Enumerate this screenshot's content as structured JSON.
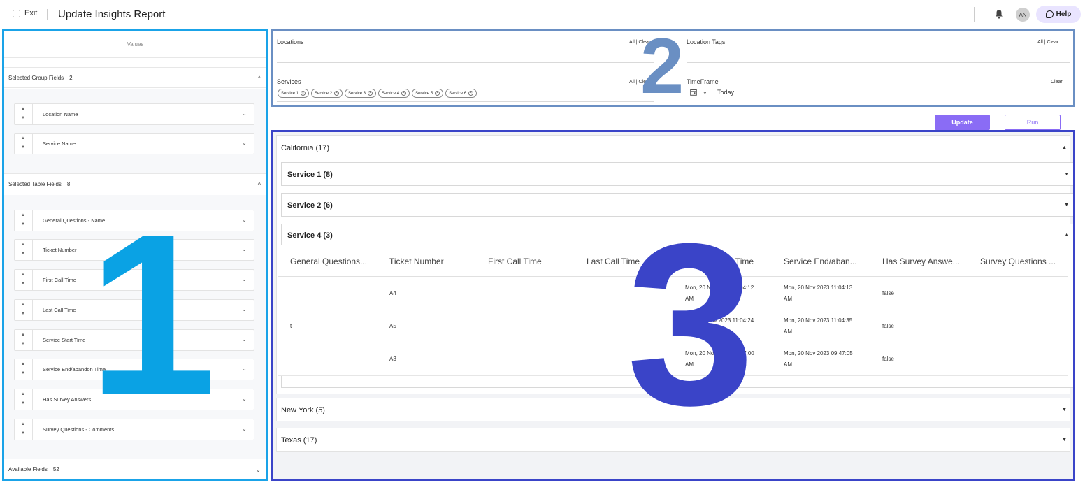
{
  "header": {
    "exit_label": "Exit",
    "title": "Update Insights Report",
    "avatar_initials": "AN",
    "help_label": "Help"
  },
  "left_panel": {
    "marker": "1",
    "values_label": "Values",
    "group_fields": {
      "label": "Selected Group Fields",
      "count": "2",
      "items": [
        "Location Name",
        "Service Name"
      ]
    },
    "table_fields": {
      "label": "Selected Table Fields",
      "count": "8",
      "items": [
        "General Questions - Name",
        "Ticket Number",
        "First Call Time",
        "Last Call Time",
        "Service Start Time",
        "Service End/abandon Time",
        "Has Survey Answers",
        "Survey Questions - Comments"
      ]
    },
    "available_fields": {
      "label": "Available Fields",
      "count": "52"
    }
  },
  "filters": {
    "marker": "2",
    "locations": {
      "label": "Locations",
      "actions": "All | Clear"
    },
    "location_tags": {
      "label": "Location Tags",
      "actions": "All | Clear"
    },
    "services": {
      "label": "Services",
      "actions": "All | Clear",
      "chips": [
        "Service 1",
        "Service 2",
        "Service 3",
        "Service 4",
        "Service 5",
        "Service 6"
      ]
    },
    "timeframe": {
      "label": "TimeFrame",
      "value": "Today",
      "clear": "Clear"
    }
  },
  "actions": {
    "update_label": "Update",
    "run_label": "Run"
  },
  "results": {
    "marker": "3",
    "groups": [
      {
        "title": "California (17)"
      },
      {
        "title": "New York (5)"
      },
      {
        "title": "Texas (17)"
      }
    ],
    "subgroups": [
      {
        "title": "Service 1 (8)"
      },
      {
        "title": "Service 2 (6)"
      },
      {
        "title": "Service 4 (3)"
      }
    ],
    "columns": [
      "General Questions...",
      "Ticket Number",
      "First Call Time",
      "Last Call Time",
      "Service Start Time",
      "Service End/aban...",
      "Has Survey Answe...",
      "Survey Questions ..."
    ],
    "rows": [
      {
        "general": "",
        "ticket": "A4",
        "start_l1": "Mon, 20 Nov 2023 11:04:12",
        "start_l2": "AM",
        "end_l1": "Mon, 20 Nov 2023 11:04:13",
        "end_l2": "AM",
        "survey": "false"
      },
      {
        "general": "t",
        "ticket": "A5",
        "start_l1": "Mon, 20 Nov 2023 11:04:24",
        "start_l2": "AM",
        "end_l1": "Mon, 20 Nov 2023 11:04:35",
        "end_l2": "AM",
        "survey": "false"
      },
      {
        "general": "",
        "ticket": "A3",
        "start_l1": "Mon, 20 Nov 2023 09:47:00",
        "start_l2": "AM",
        "end_l1": "Mon, 20 Nov 2023 09:47:05",
        "end_l2": "AM",
        "survey": "false"
      }
    ]
  }
}
